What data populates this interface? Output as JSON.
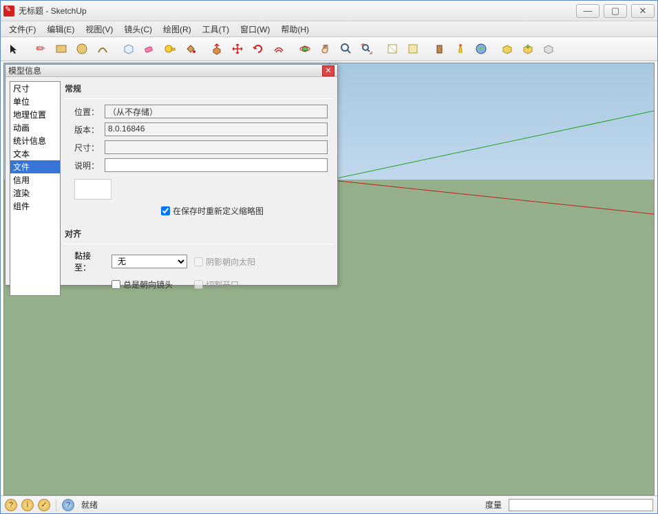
{
  "window": {
    "title": "无标题 - SketchUp"
  },
  "menu": {
    "file": "文件(F)",
    "edit": "编辑(E)",
    "view": "视图(V)",
    "camera": "镜头(C)",
    "draw": "绘图(R)",
    "tools": "工具(T)",
    "window": "窗口(W)",
    "help": "帮助(H)"
  },
  "dialog": {
    "title": "模型信息",
    "categories": [
      "尺寸",
      "单位",
      "地理位置",
      "动画",
      "统计信息",
      "文本",
      "文件",
      "信用",
      "渲染",
      "组件"
    ],
    "selected_index": 6,
    "general_header": "常规",
    "location_label": "位置：",
    "location_value": "（从不存储）",
    "version_label": "版本：",
    "version_value": "8.0.16846",
    "size_label": "尺寸：",
    "size_value": "",
    "desc_label": "说明：",
    "desc_value": "",
    "redef_thumb_label": "在保存时重新定义缩略图",
    "redef_thumb_checked": true,
    "align_header": "对齐",
    "glue_label": "黏接至：",
    "glue_value": "无",
    "always_face_label": "总是朝向镜头",
    "shadows_face_sun_label": "阴影朝向太阳",
    "cut_opening_label": "切割开口"
  },
  "status": {
    "ready": "就绪",
    "measure_label": "度量"
  }
}
